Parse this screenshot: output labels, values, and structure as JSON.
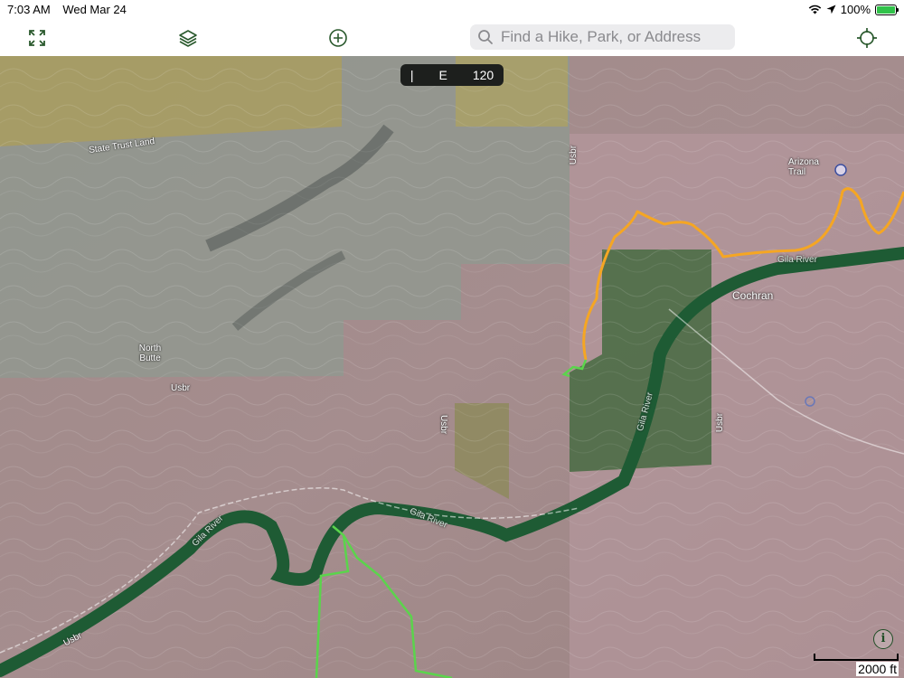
{
  "status": {
    "time": "7:03 AM",
    "date": "Wed Mar 24",
    "battery": "100%"
  },
  "toolbar": {
    "search_placeholder": "Find a Hike, Park, or Address"
  },
  "compass": {
    "left": "",
    "heading": "E",
    "degrees": "120"
  },
  "map": {
    "labels": {
      "state_trust_land": "State Trust Land",
      "usbr_left": "Usbr",
      "usbr_mid": "Usbr",
      "usbr_top": "Usbr",
      "usbr_right": "Usbr",
      "usbr_bottom": "Usbr",
      "north_butte": "North Butte",
      "arizona_trail": "Arizona Trail",
      "cochran": "Cochran",
      "gila_river_1": "Gila River",
      "gila_river_2": "Gila River",
      "gila_river_3": "Gila River",
      "gila_river_4": "Gila River"
    },
    "scale_label": "2000 ft",
    "info_label": "i",
    "colors": {
      "trail_orange": "#f5a623",
      "trail_green": "#5bd44c",
      "river": "#1e5b34",
      "state_land": "#8f9a80",
      "private_land": "#b39a8b"
    }
  }
}
